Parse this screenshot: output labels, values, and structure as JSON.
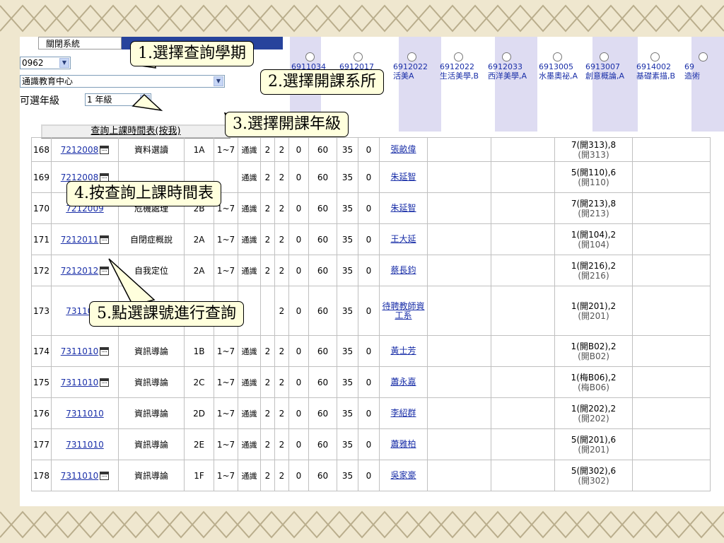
{
  "toolbar": {
    "close_label": "關閉系統",
    "semester_value": "0962",
    "department_value": "通識教育中心",
    "grade_label": "可選年級",
    "grade_value": "1 年級",
    "query_button_label": "查詢上課時間表(按我)"
  },
  "course_columns": [
    {
      "code": "6911034",
      "name": ""
    },
    {
      "code": "6912017",
      "name": ""
    },
    {
      "code": "6912022",
      "name": "活美A"
    },
    {
      "code": "6912022",
      "name": "生活美學,B"
    },
    {
      "code": "6912033",
      "name": "西洋美學,A"
    },
    {
      "code": "6913005",
      "name": "水墨奧祕,A"
    },
    {
      "code": "6913007",
      "name": "創意概論,A"
    },
    {
      "code": "6914002",
      "name": "基礎素描,B"
    },
    {
      "code": "69",
      "name": "造術"
    }
  ],
  "rows": [
    {
      "no": "168",
      "code": "7212008",
      "cal": true,
      "name": "資料選讀",
      "cls": "1A",
      "grade": "1~7",
      "cat": "通識",
      "c1": "2",
      "c2": "2",
      "c3": "0",
      "c4": "60",
      "c5": "35",
      "c6": "0",
      "teacher": "張畝偉",
      "sched": "7(開313),8",
      "room": "(開313)"
    },
    {
      "no": "169",
      "code": "7212008",
      "cal": true,
      "name": "",
      "cls": "",
      "grade": "",
      "cat": "通識",
      "c1": "2",
      "c2": "2",
      "c3": "0",
      "c4": "60",
      "c5": "35",
      "c6": "0",
      "teacher": "朱延智",
      "sched": "5(開110),6",
      "room": "(開110)"
    },
    {
      "no": "170",
      "code": "7212009",
      "cal": false,
      "name": "危機處理",
      "cls": "2B",
      "grade": "1~7",
      "cat": "通識",
      "c1": "2",
      "c2": "2",
      "c3": "0",
      "c4": "60",
      "c5": "35",
      "c6": "0",
      "teacher": "朱延智",
      "sched": "7(開213),8",
      "room": "(開213)"
    },
    {
      "no": "171",
      "code": "7212011",
      "cal": true,
      "name": "自閉症概說",
      "cls": "2A",
      "grade": "1~7",
      "cat": "通識",
      "c1": "2",
      "c2": "2",
      "c3": "0",
      "c4": "60",
      "c5": "35",
      "c6": "0",
      "teacher": "王大延",
      "sched": "1(開104),2",
      "room": "(開104)"
    },
    {
      "no": "172",
      "code": "7212012",
      "cal": true,
      "name": "自我定位",
      "cls": "2A",
      "grade": "1~7",
      "cat": "通識",
      "c1": "2",
      "c2": "2",
      "c3": "0",
      "c4": "60",
      "c5": "35",
      "c6": "0",
      "teacher": "蔡長鈞",
      "sched": "1(開216),2",
      "room": "(開216)"
    },
    {
      "no": "173",
      "code": "7311010",
      "cal": false,
      "name": "",
      "cls": "",
      "grade": "",
      "cat": "",
      "c1": "",
      "c2": "2",
      "c3": "0",
      "c4": "60",
      "c5": "35",
      "c6": "0",
      "teacher": "待聘教師資工系",
      "sched": "1(開201),2",
      "room": "(開201)"
    },
    {
      "no": "174",
      "code": "7311010",
      "cal": true,
      "name": "資訊導論",
      "cls": "1B",
      "grade": "1~7",
      "cat": "通識",
      "c1": "2",
      "c2": "2",
      "c3": "0",
      "c4": "60",
      "c5": "35",
      "c6": "0",
      "teacher": "黃士芳",
      "sched": "1(開B02),2",
      "room": "(開B02)"
    },
    {
      "no": "175",
      "code": "7311010",
      "cal": true,
      "name": "資訊導論",
      "cls": "2C",
      "grade": "1~7",
      "cat": "通識",
      "c1": "2",
      "c2": "2",
      "c3": "0",
      "c4": "60",
      "c5": "35",
      "c6": "0",
      "teacher": "蕭永嘉",
      "sched": "1(梅B06),2",
      "room": "(梅B06)"
    },
    {
      "no": "176",
      "code": "7311010",
      "cal": false,
      "name": "資訊導論",
      "cls": "2D",
      "grade": "1~7",
      "cat": "通識",
      "c1": "2",
      "c2": "2",
      "c3": "0",
      "c4": "60",
      "c5": "35",
      "c6": "0",
      "teacher": "李紹群",
      "sched": "1(開202),2",
      "room": "(開202)"
    },
    {
      "no": "177",
      "code": "7311010",
      "cal": false,
      "name": "資訊導論",
      "cls": "2E",
      "grade": "1~7",
      "cat": "通識",
      "c1": "2",
      "c2": "2",
      "c3": "0",
      "c4": "60",
      "c5": "35",
      "c6": "0",
      "teacher": "蕭雅柏",
      "sched": "5(開201),6",
      "room": "(開201)"
    },
    {
      "no": "178",
      "code": "7311010",
      "cal": true,
      "name": "資訊導論",
      "cls": "1F",
      "grade": "1~7",
      "cat": "通識",
      "c1": "2",
      "c2": "2",
      "c3": "0",
      "c4": "60",
      "c5": "35",
      "c6": "0",
      "teacher": "吳家豪",
      "sched": "5(開302),6",
      "room": "(開302)"
    }
  ],
  "callouts": {
    "step1": "1.選擇查詢學期",
    "step2": "2.選擇開課系所",
    "step3": "3.選擇開課年級",
    "step4": "4.按查詢上課時間表",
    "step5": "5.點選課號進行查詢"
  },
  "colors": {
    "link": "#1a2fa8",
    "header_shade": "#dedcf2",
    "callout_fill": "#ffffdd",
    "zero_red": "#e00000",
    "background": "#efe7cf"
  }
}
